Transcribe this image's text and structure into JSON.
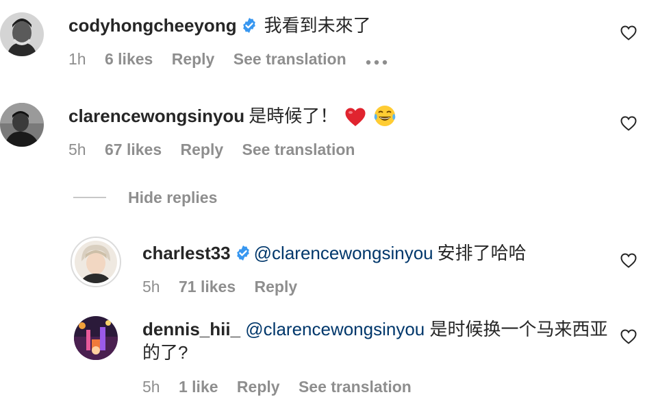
{
  "comments": [
    {
      "username": "codyhongcheeyong",
      "verified": true,
      "text": "我看到未來了",
      "time": "1h",
      "likes": "6 likes",
      "reply": "Reply",
      "translation": "See translation"
    },
    {
      "username": "clarencewongsinyou",
      "verified": false,
      "text": "是時候了！",
      "emojis": [
        "heart",
        "tears-of-joy"
      ],
      "time": "5h",
      "likes": "67 likes",
      "reply": "Reply",
      "translation": "See translation"
    }
  ],
  "replies_toggle": {
    "label": "Hide replies"
  },
  "replies": [
    {
      "username": "charlest33",
      "verified": true,
      "mention": "@clarencewongsinyou",
      "text": "安排了哈哈",
      "time": "5h",
      "likes": "71 likes",
      "reply": "Reply"
    },
    {
      "username": "dennis_hii_",
      "verified": false,
      "mention": "@clarencewongsinyou",
      "text": "是时候换一个马来西亚的了?",
      "time": "5h",
      "likes": "1 like",
      "reply": "Reply",
      "translation": "See translation"
    }
  ],
  "colors": {
    "text": "#262626",
    "secondary": "#8e8e8e",
    "mention": "#00376b",
    "verified": "#3897f0"
  }
}
